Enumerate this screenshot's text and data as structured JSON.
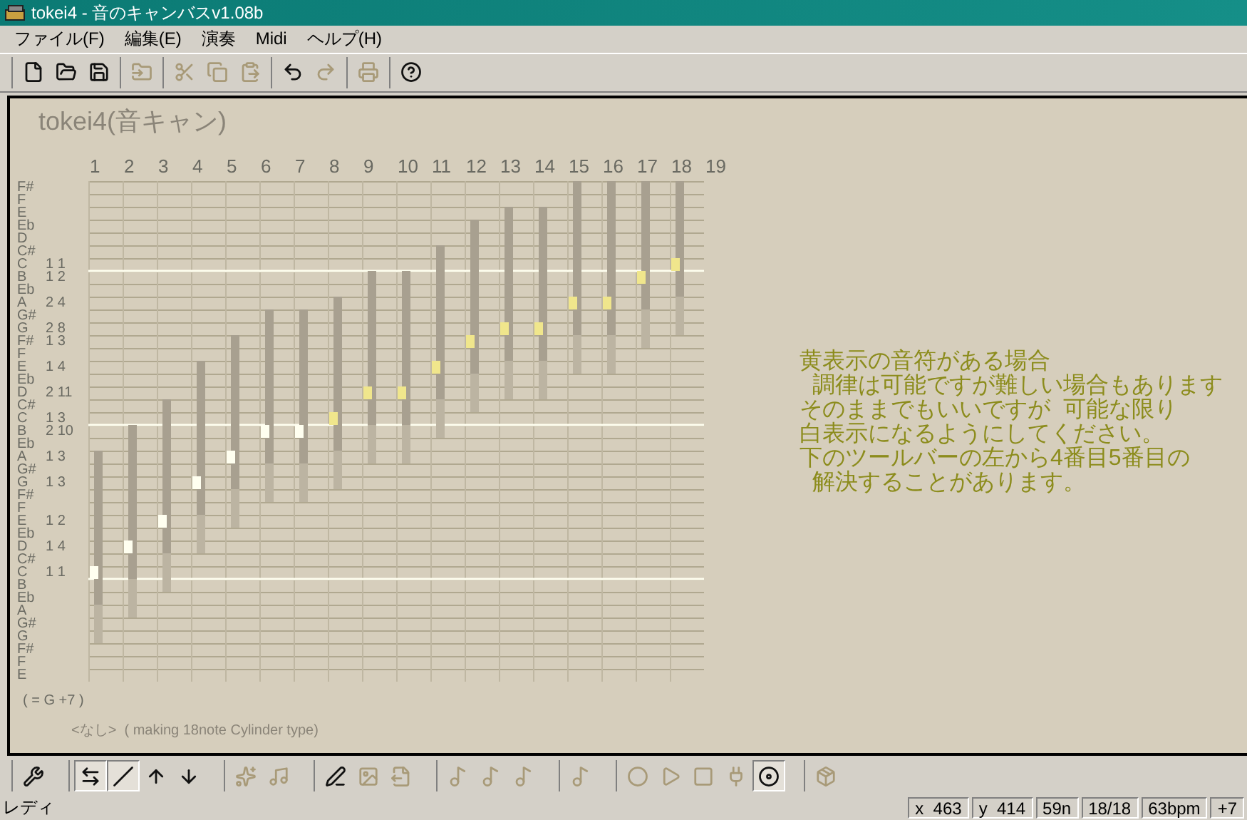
{
  "window": {
    "title": "tokei4 - 音のキャンバスv1.08b"
  },
  "menu": [
    "ファイル(F)",
    "編集(E)",
    "演奏",
    "Midi",
    "ヘルプ(H)"
  ],
  "toolbar": [
    {
      "items": [
        {
          "kind": "new",
          "disabled": false
        },
        {
          "kind": "open",
          "disabled": false
        },
        {
          "kind": "save",
          "disabled": false
        }
      ]
    },
    {
      "items": [
        {
          "kind": "folder",
          "disabled": true
        }
      ]
    },
    {
      "items": [
        {
          "kind": "cut",
          "disabled": true
        },
        {
          "kind": "copy",
          "disabled": true
        },
        {
          "kind": "paste",
          "disabled": true
        }
      ]
    },
    {
      "items": [
        {
          "kind": "undo",
          "disabled": false
        },
        {
          "kind": "redo",
          "disabled": true
        }
      ]
    },
    {
      "items": [
        {
          "kind": "print",
          "disabled": true
        }
      ]
    },
    {
      "items": [
        {
          "kind": "help",
          "disabled": false
        }
      ]
    }
  ],
  "canvas": {
    "title": "tokei4(音キャン)",
    "columns": [
      "1",
      "2",
      "3",
      "4",
      "5",
      "6",
      "7",
      "8",
      "9",
      "10",
      "11",
      "12",
      "13",
      "14",
      "15",
      "16",
      "17",
      "18",
      "19"
    ],
    "rows": [
      {
        "note": "F#"
      },
      {
        "note": "F"
      },
      {
        "note": "E"
      },
      {
        "note": "Eb"
      },
      {
        "note": "D"
      },
      {
        "note": "C#"
      },
      {
        "note": "C",
        "count": "1 1",
        "markers": [
          {
            "color": "#f0e68c"
          }
        ]
      },
      {
        "note": "B",
        "count": "1 2",
        "markers": [
          {
            "color": "#f0e68c"
          }
        ]
      },
      {
        "note": "Eb"
      },
      {
        "note": "A",
        "count": "2 4",
        "markers": [
          {
            "color": "#f0e68c"
          },
          {
            "color": "#f0e68c"
          }
        ]
      },
      {
        "note": "G#"
      },
      {
        "note": "G",
        "count": "2 8",
        "markers": [
          {
            "color": "#f0e68c"
          },
          {
            "color": "#f0e68c"
          }
        ]
      },
      {
        "note": "F#",
        "count": "1 3",
        "markers": [
          {
            "color": "#f0e68c"
          }
        ]
      },
      {
        "note": "F"
      },
      {
        "note": "E",
        "count": "1 4",
        "markers": [
          {
            "color": "#f0e68c"
          }
        ]
      },
      {
        "note": "Eb"
      },
      {
        "note": "D",
        "count": "2 11",
        "markers": [
          {
            "color": "#f0e68c"
          },
          {
            "color": "#f0e68c"
          }
        ]
      },
      {
        "note": "C#"
      },
      {
        "note": "C",
        "count": "1 3",
        "markers": [
          {
            "color": "#f0e68c"
          }
        ]
      },
      {
        "note": "B",
        "count": "2 10",
        "markers": [
          {
            "color": "#fffff0"
          },
          {
            "color": "#fffff0"
          }
        ]
      },
      {
        "note": "Eb"
      },
      {
        "note": "A",
        "count": "1 3",
        "markers": [
          {
            "color": "#fffff0"
          }
        ]
      },
      {
        "note": "G#"
      },
      {
        "note": "G",
        "count": "1 3",
        "markers": [
          {
            "color": "#fffff0"
          }
        ]
      },
      {
        "note": "F#"
      },
      {
        "note": "F"
      },
      {
        "note": "E",
        "count": "1 2",
        "markers": [
          {
            "color": "#fffff0"
          }
        ]
      },
      {
        "note": "Eb"
      },
      {
        "note": "D",
        "count": "1 4",
        "markers": [
          {
            "color": "#fffff0"
          }
        ]
      },
      {
        "note": "C#"
      },
      {
        "note": "C",
        "count": "1 1",
        "markers": [
          {
            "color": "#fffff0"
          }
        ]
      },
      {
        "note": "B"
      },
      {
        "note": "Eb"
      },
      {
        "note": "A"
      },
      {
        "note": "G#"
      },
      {
        "note": "G"
      },
      {
        "note": "F#"
      },
      {
        "note": "F"
      },
      {
        "note": "E"
      }
    ],
    "transpose": "( = G +7 )",
    "footer": "<なし>  ( making 18note Cylinder type)",
    "message": [
      "黄表示の音符がある場合",
      "  調律は可能ですが難しい場合もあります",
      "そのままでもいいですが  可能な限り",
      "白表示になるようにしてください。",
      "下のツールバーの左から4番目5番目の",
      "  解決することがあります。"
    ]
  },
  "bottom_toolbar": [
    {
      "items": [
        {
          "kind": "wrench",
          "disabled": false,
          "pressed": false
        }
      ]
    },
    {
      "items": [
        {
          "kind": "swap",
          "disabled": false,
          "pressed": true
        },
        {
          "kind": "line",
          "disabled": false,
          "pressed": true
        },
        {
          "kind": "note-up",
          "disabled": false,
          "pressed": false
        },
        {
          "kind": "note-down",
          "disabled": false,
          "pressed": false
        }
      ]
    },
    {
      "items": [
        {
          "kind": "sparkle-note",
          "disabled": true,
          "pressed": false
        },
        {
          "kind": "notes",
          "disabled": true,
          "pressed": false
        }
      ]
    },
    {
      "items": [
        {
          "kind": "pen-plus",
          "disabled": false,
          "pressed": false
        },
        {
          "kind": "image",
          "disabled": true,
          "pressed": false
        },
        {
          "kind": "export",
          "disabled": true,
          "pressed": false
        }
      ]
    },
    {
      "items": [
        {
          "kind": "chord",
          "disabled": true,
          "pressed": false
        },
        {
          "kind": "chord",
          "disabled": true,
          "pressed": false
        },
        {
          "kind": "chord",
          "disabled": true,
          "pressed": false
        }
      ]
    },
    {
      "items": [
        {
          "kind": "chord",
          "disabled": true,
          "pressed": false
        }
      ]
    },
    {
      "items": [
        {
          "kind": "record",
          "disabled": true,
          "pressed": false
        },
        {
          "kind": "play",
          "disabled": true,
          "pressed": false
        },
        {
          "kind": "stop",
          "disabled": true,
          "pressed": false
        },
        {
          "kind": "plug",
          "disabled": true,
          "pressed": false
        },
        {
          "kind": "target",
          "disabled": false,
          "pressed": true
        }
      ]
    },
    {
      "items": [
        {
          "kind": "box",
          "disabled": true,
          "pressed": false
        }
      ]
    }
  ],
  "status_bar": {
    "text": "レディ",
    "panels": [
      "x  463",
      "y  414",
      "59n",
      "18/18",
      "63bpm",
      "+7"
    ]
  }
}
